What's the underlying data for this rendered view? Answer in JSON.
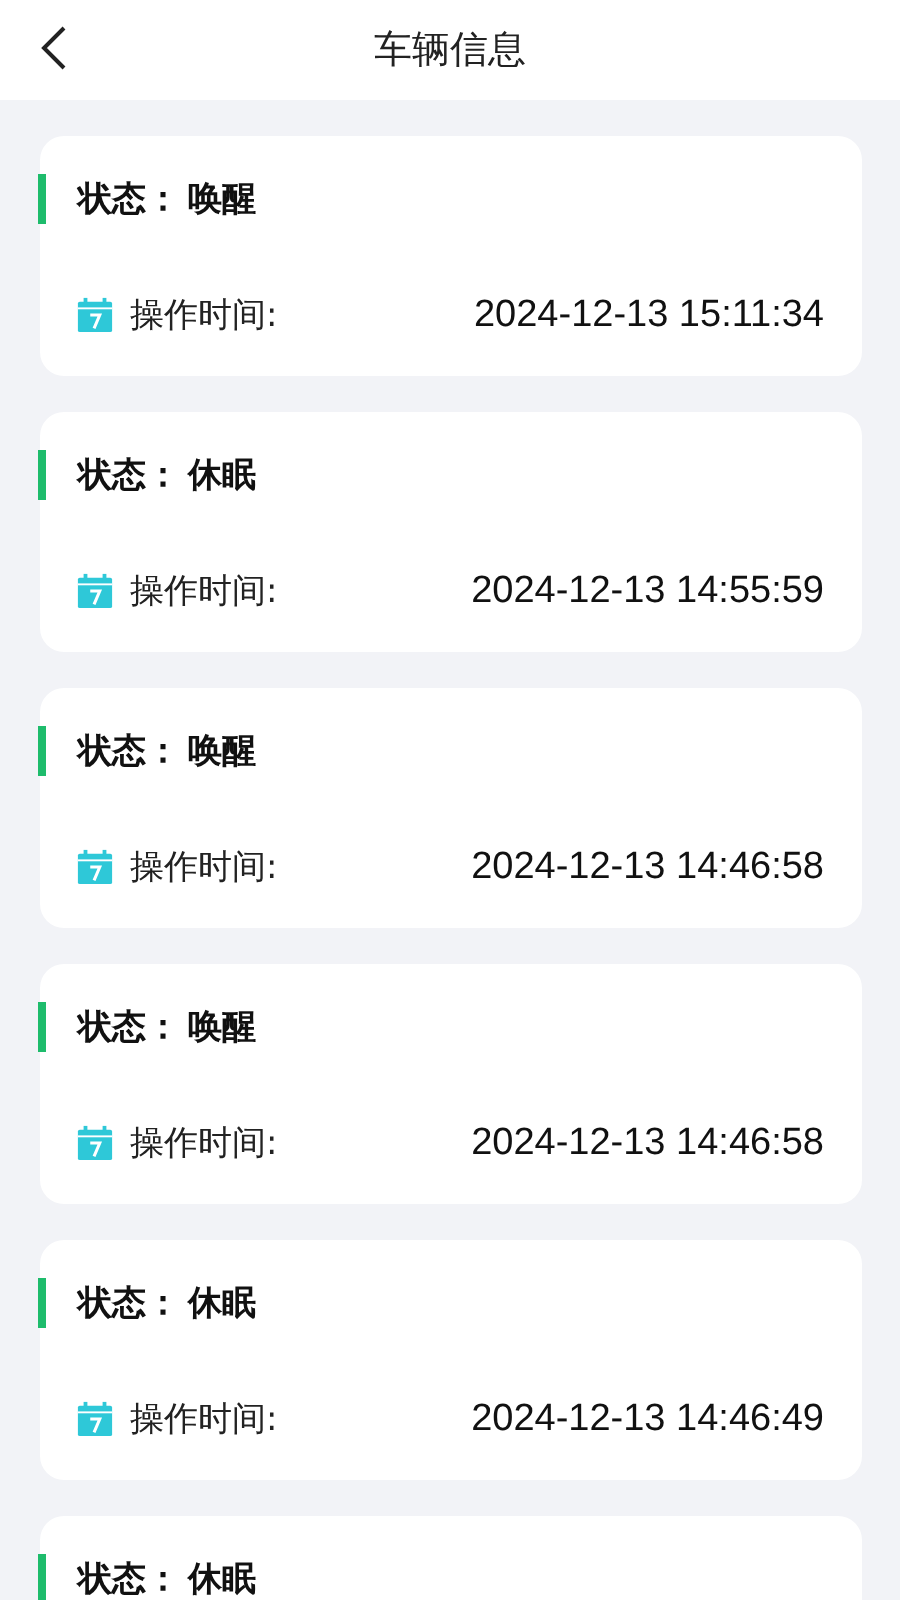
{
  "header": {
    "title": "车辆信息"
  },
  "records": [
    {
      "status_label": "状态：",
      "status": "唤醒",
      "time_label": "操作时间:",
      "time": "2024-12-13 15:11:34"
    },
    {
      "status_label": "状态：",
      "status": "休眠",
      "time_label": "操作时间:",
      "time": "2024-12-13 14:55:59"
    },
    {
      "status_label": "状态：",
      "status": "唤醒",
      "time_label": "操作时间:",
      "time": "2024-12-13 14:46:58"
    },
    {
      "status_label": "状态：",
      "status": "唤醒",
      "time_label": "操作时间:",
      "time": "2024-12-13 14:46:58"
    },
    {
      "status_label": "状态：",
      "status": "休眠",
      "time_label": "操作时间:",
      "time": "2024-12-13 14:46:49"
    },
    {
      "status_label": "状态：",
      "status": "休眠"
    }
  ]
}
